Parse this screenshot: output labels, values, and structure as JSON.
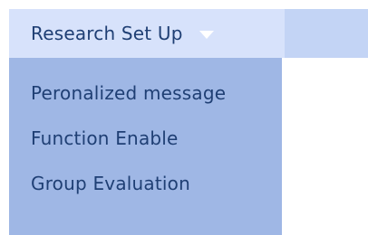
{
  "menu": {
    "trigger_label": "Research Set Up",
    "trigger_icon": "chevron-down-icon",
    "items": [
      {
        "label": "Peronalized message"
      },
      {
        "label": "Function Enable"
      },
      {
        "label": "Group Evaluation"
      }
    ]
  },
  "colors": {
    "trigger_bg": "#d7e2fb",
    "bar_bg": "#c3d4f5",
    "dropdown_bg": "#9fb7e5",
    "text": "#1f3f74"
  }
}
